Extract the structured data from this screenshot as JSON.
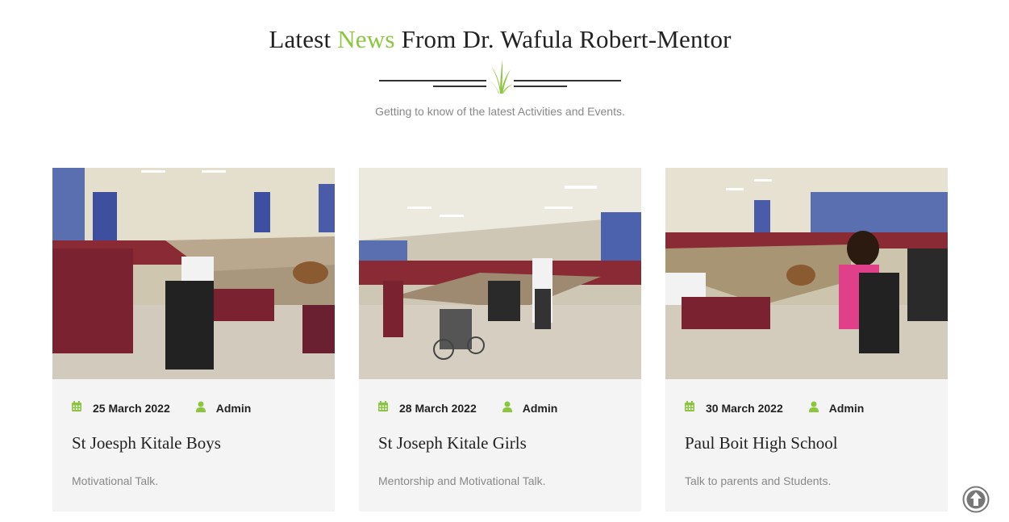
{
  "section": {
    "title_before": "Latest",
    "title_accent": "News",
    "title_after": "From Dr. Wafula Robert-Mentor",
    "subtitle": "Getting to know of the latest Activities and Events."
  },
  "colors": {
    "accent": "#8cc63f",
    "card_bg": "#f4f4f4",
    "muted_text": "#888888"
  },
  "icons": {
    "divider": "grass-icon",
    "date": "calendar-icon",
    "author": "user-icon",
    "scroll_top": "arrow-up-circle-icon"
  },
  "posts": [
    {
      "date": "25 March 2022",
      "author": "Admin",
      "title": "St Joesph Kitale Boys",
      "excerpt": "Motivational Talk."
    },
    {
      "date": "28 March 2022",
      "author": "Admin",
      "title": "St Joseph Kitale Girls",
      "excerpt": "Mentorship and Motivational Talk."
    },
    {
      "date": "30 March 2022",
      "author": "Admin",
      "title": "Paul Boit High School",
      "excerpt": "Talk to parents and Students."
    }
  ]
}
